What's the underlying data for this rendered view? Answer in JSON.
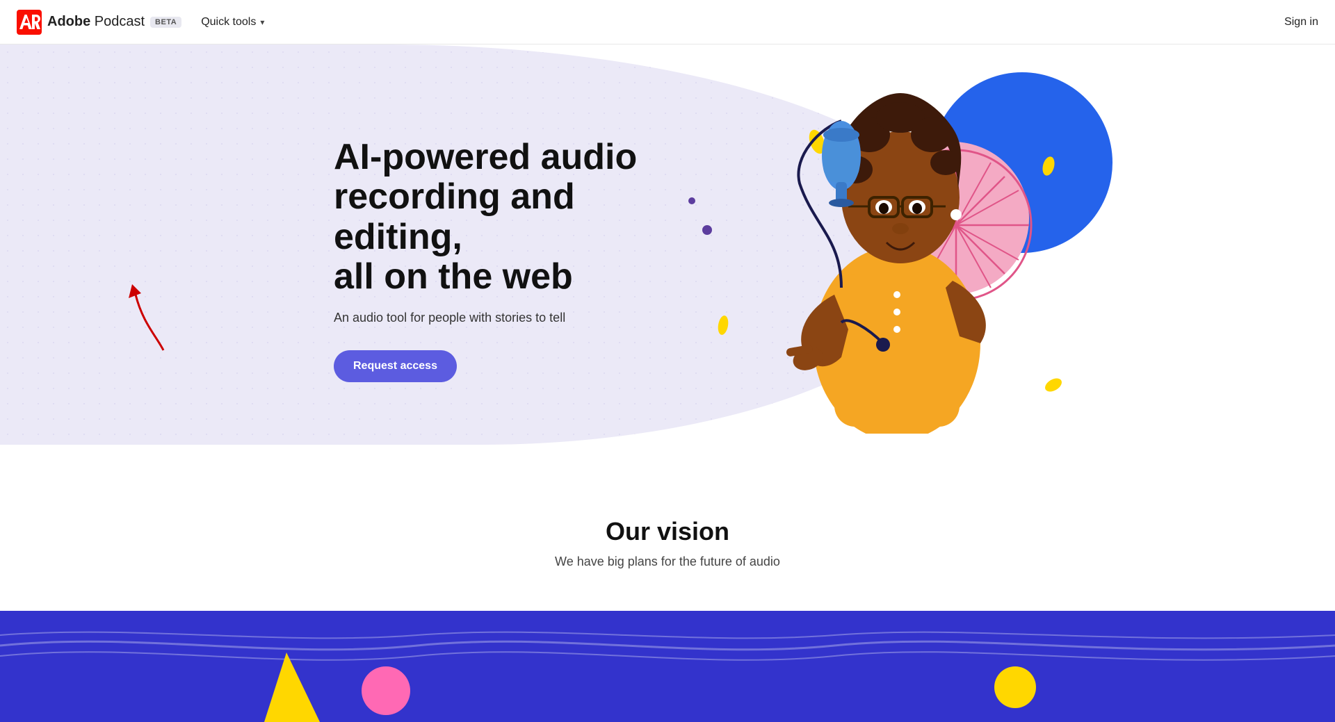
{
  "nav": {
    "brand": "Adobe",
    "product": "Podcast",
    "beta_label": "BETA",
    "quick_tools_label": "Quick tools",
    "sign_in_label": "Sign in"
  },
  "hero": {
    "heading_line1": "AI-powered audio",
    "heading_line2": "recording and editing,",
    "heading_line3": "all on the web",
    "subtext": "An audio tool for people with stories to tell",
    "cta_label": "Request access"
  },
  "vision": {
    "title": "Our vision",
    "subtitle": "We have big plans for the future of audio"
  },
  "colors": {
    "blob_bg": "#ebe9f7",
    "cta_bg": "#5c5ce0",
    "blue_circle": "#2563eb",
    "pink_circle": "#f4aac4",
    "bottom_bg": "#3333cc",
    "yellow": "#ffd700",
    "pink": "#ff69b4"
  }
}
